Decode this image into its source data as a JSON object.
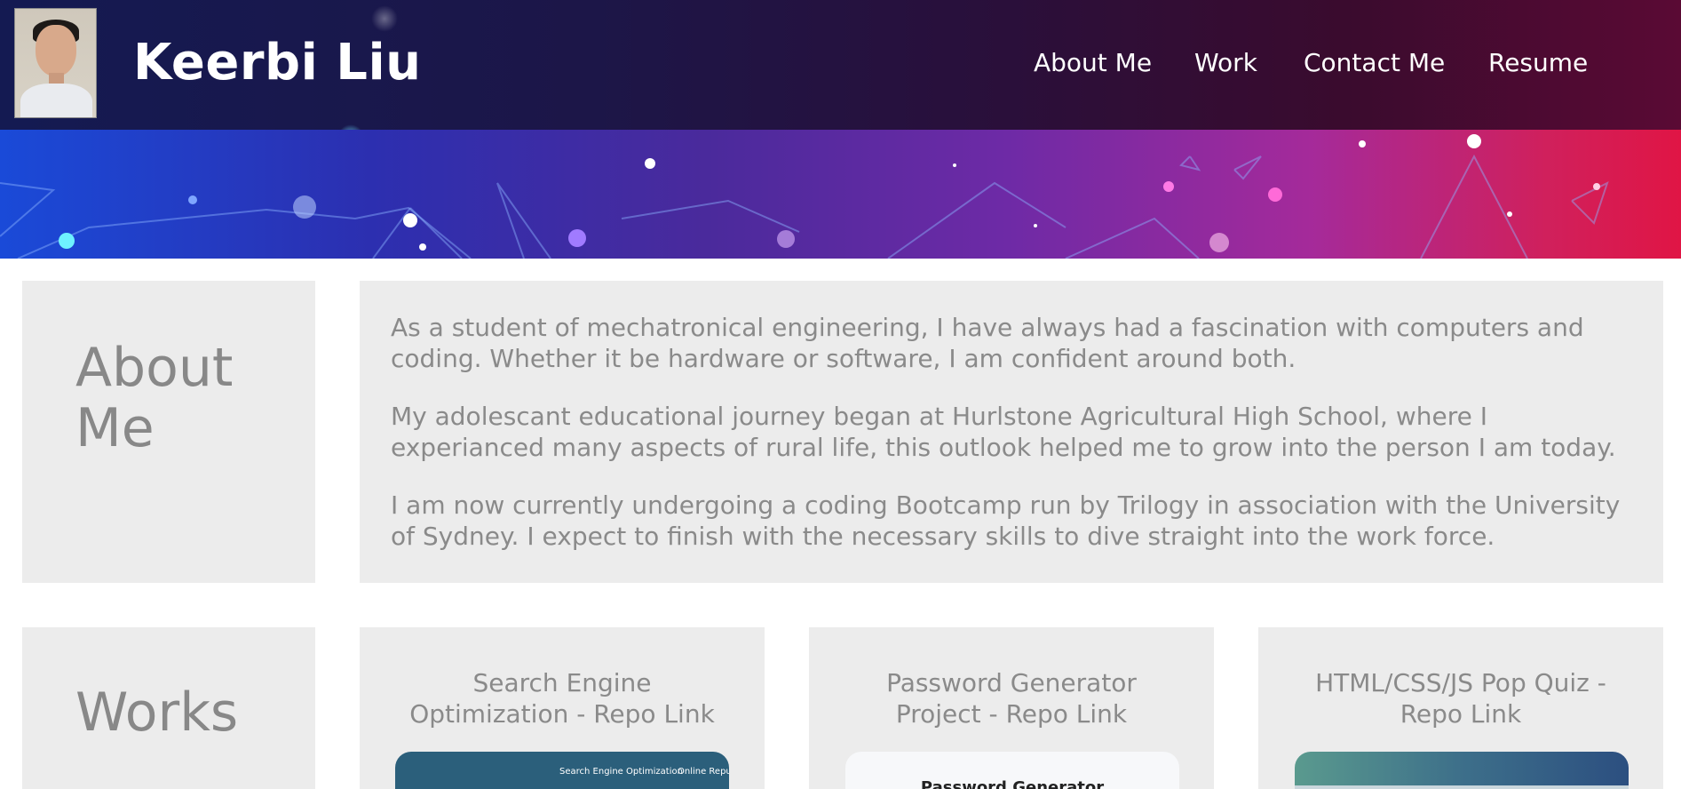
{
  "header": {
    "site_title": "Keerbi Liu",
    "nav": [
      {
        "label": "About Me"
      },
      {
        "label": "Work"
      },
      {
        "label": "Contact Me"
      },
      {
        "label": "Resume"
      }
    ]
  },
  "about": {
    "heading_line1": "About",
    "heading_line2": "Me",
    "paragraphs": [
      "As a student of mechatronical engineering, I have always had a fascination with computers and coding. Whether it be hardware or software, I am confident around both.",
      "My adolescant educational journey began at Hurlstone Agricultural High School, where I experianced many aspects of rural life, this outlook helped me to grow into the person I am today.",
      "I am now currently undergoing a coding Bootcamp run by Trilogy in association with the University of Sydney. I expect to finish with the necessary skills to dive straight into the work force."
    ]
  },
  "works": {
    "heading": "Works",
    "items": [
      {
        "title": "Search Engine Optimization - Repo Link",
        "thumb_text_1": "Search Engine Optimization",
        "thumb_text_2": "Online Reput"
      },
      {
        "title": "Password Generator Project - Repo Link",
        "thumb_text_1": "Password Generator"
      },
      {
        "title": "HTML/CSS/JS Pop Quiz - Repo Link"
      }
    ]
  },
  "colors": {
    "card_bg": "#ececec",
    "text_gray": "#8a8a8a",
    "header_left": "#141a52",
    "header_right": "#5a0a34"
  }
}
